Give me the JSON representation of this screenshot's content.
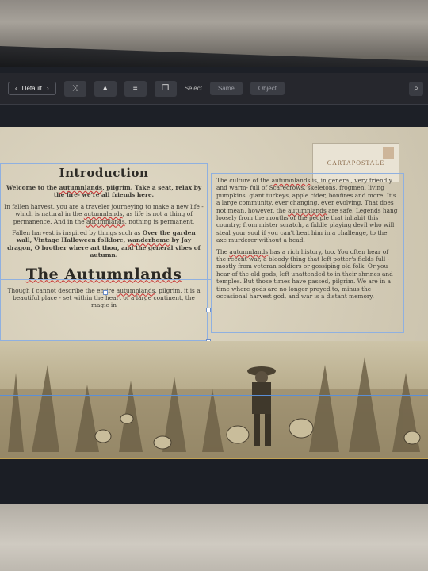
{
  "toolbar": {
    "default_label": "Default",
    "select_label": "Select",
    "same_label": "Same",
    "object_label": "Object"
  },
  "left_column": {
    "heading": "Introduction",
    "welcome_pre": "Welcome to the ",
    "welcome_kw": "autumnlands",
    "welcome_post": ", pilgrim. Take a seat, relax by the fire- we're all friends here.",
    "p2_pre": "In fallen harvest, you are a traveler journeying to make a new life - which is natural in the ",
    "p2_kw1": "autumnlands",
    "p2_mid": ", as life is not a thing of permanence. And in the ",
    "p2_kw2": "autumnlands",
    "p2_post": ", nothing is permanent.",
    "p3_pre": "Fallen harvest is inspired by things such as ",
    "p3_b1": "Over the garden wall, Vintage Halloween folklore, ",
    "p3_kw": "wanderhome",
    "p3_b2": " by Jay dragon, O brother where art thou, and the general vibes of autumn.",
    "heading2": "The Autumnlands",
    "p4_pre": "Though I cannot describe the entire ",
    "p4_kw": "autumnlands",
    "p4_post": ", pilgrim, it is a beautiful place - set within the heart of a large continent, the magic in"
  },
  "right_column": {
    "p1_pre": "The culture of the ",
    "p1_kw1": "autumnlands",
    "p1_mid": " is, in general, very friendly and warm- full of Scarecrows, skeletons, frogmen, living pumpkins, giant turkeys, apple cider, bonfires and more. It's a large community, ever changing, ever evolving. That does not mean, however, the ",
    "p1_kw2": "autumnlands",
    "p1_post": " are safe. Legends hang loosely from the mouths of the people that inhabit this country; from mister scratch, a fiddle playing devil who will steal your soul if you can't beat him in a challenge, to the axe murderer without a head.",
    "p2_pre": "The ",
    "p2_kw": "autumnlands",
    "p2_post": " has a rich history, too. You often hear of the recent war, a bloody thing that left potter's fields full - mostly from veteran soldiers or gossiping old folk. Or you hear of the old gods, left unattended to in their shrines and temples. But those times have passed, pilgrim. We are in a time where gods are no longer prayed to, minus the occasional harvest god, and war is a distant memory."
  },
  "stamp": {
    "text": "CARTAPOSTALE"
  },
  "icons": [
    "chevron-left-icon",
    "chevron-right-icon",
    "shuffle-icon",
    "triangle-icon",
    "align-icon",
    "copy-icon",
    "search-icon"
  ],
  "colors": {
    "toolbar_bg": "#26272d",
    "page_bg": "#d8d1bd",
    "guide": "#7aa0d8",
    "spell": "#c93030"
  }
}
